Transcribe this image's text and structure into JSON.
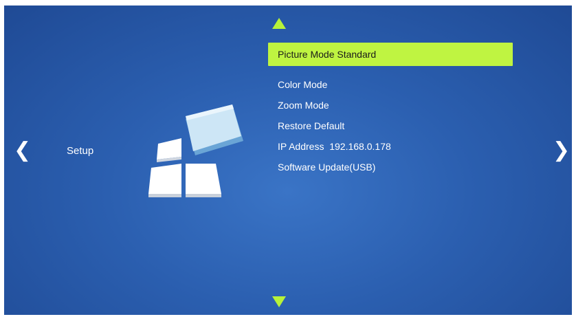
{
  "navigation": {
    "left_arrow": "❮",
    "right_arrow": "❯"
  },
  "category": {
    "label": "Setup",
    "icon": "setup-blocks-icon"
  },
  "scroll_indicators": {
    "up": "triangle-up-icon",
    "down": "triangle-down-icon"
  },
  "menu": {
    "items": [
      {
        "label": "Picture Mode Standard",
        "selected": true
      },
      {
        "label": "Color Mode",
        "selected": false
      },
      {
        "label": "Zoom Mode",
        "selected": false
      },
      {
        "label": "Restore Default",
        "selected": false
      },
      {
        "label": "IP Address  192.168.0.178",
        "selected": false
      },
      {
        "label": "Software Update(USB)",
        "selected": false
      }
    ]
  },
  "colors": {
    "highlight": "#bff441",
    "arrow_accent": "#b7f23a",
    "background": "#2b5fb0",
    "text": "#ffffff"
  }
}
